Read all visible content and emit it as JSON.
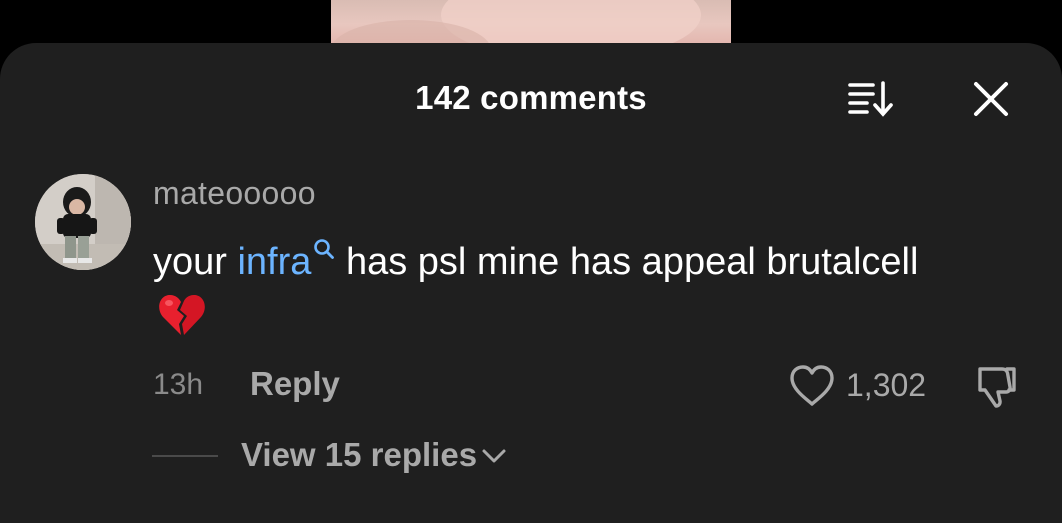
{
  "sheet": {
    "title": "142 comments"
  },
  "header_icons": {
    "sort": "sort-descending-icon",
    "close": "close-icon"
  },
  "comment": {
    "username": "mateooooo",
    "text_before": "your ",
    "search_term": "infra",
    "text_after": " has psl mine has appeal brutalcell",
    "emoji": "broken-heart-emoji",
    "time": "13h",
    "reply_label": "Reply",
    "like_count": "1,302",
    "view_replies_label": "View 15 replies"
  },
  "colors": {
    "sheet_background": "#1f1f1f",
    "search_link": "#6cb4ff",
    "secondary_text": "#a9a9a9"
  }
}
